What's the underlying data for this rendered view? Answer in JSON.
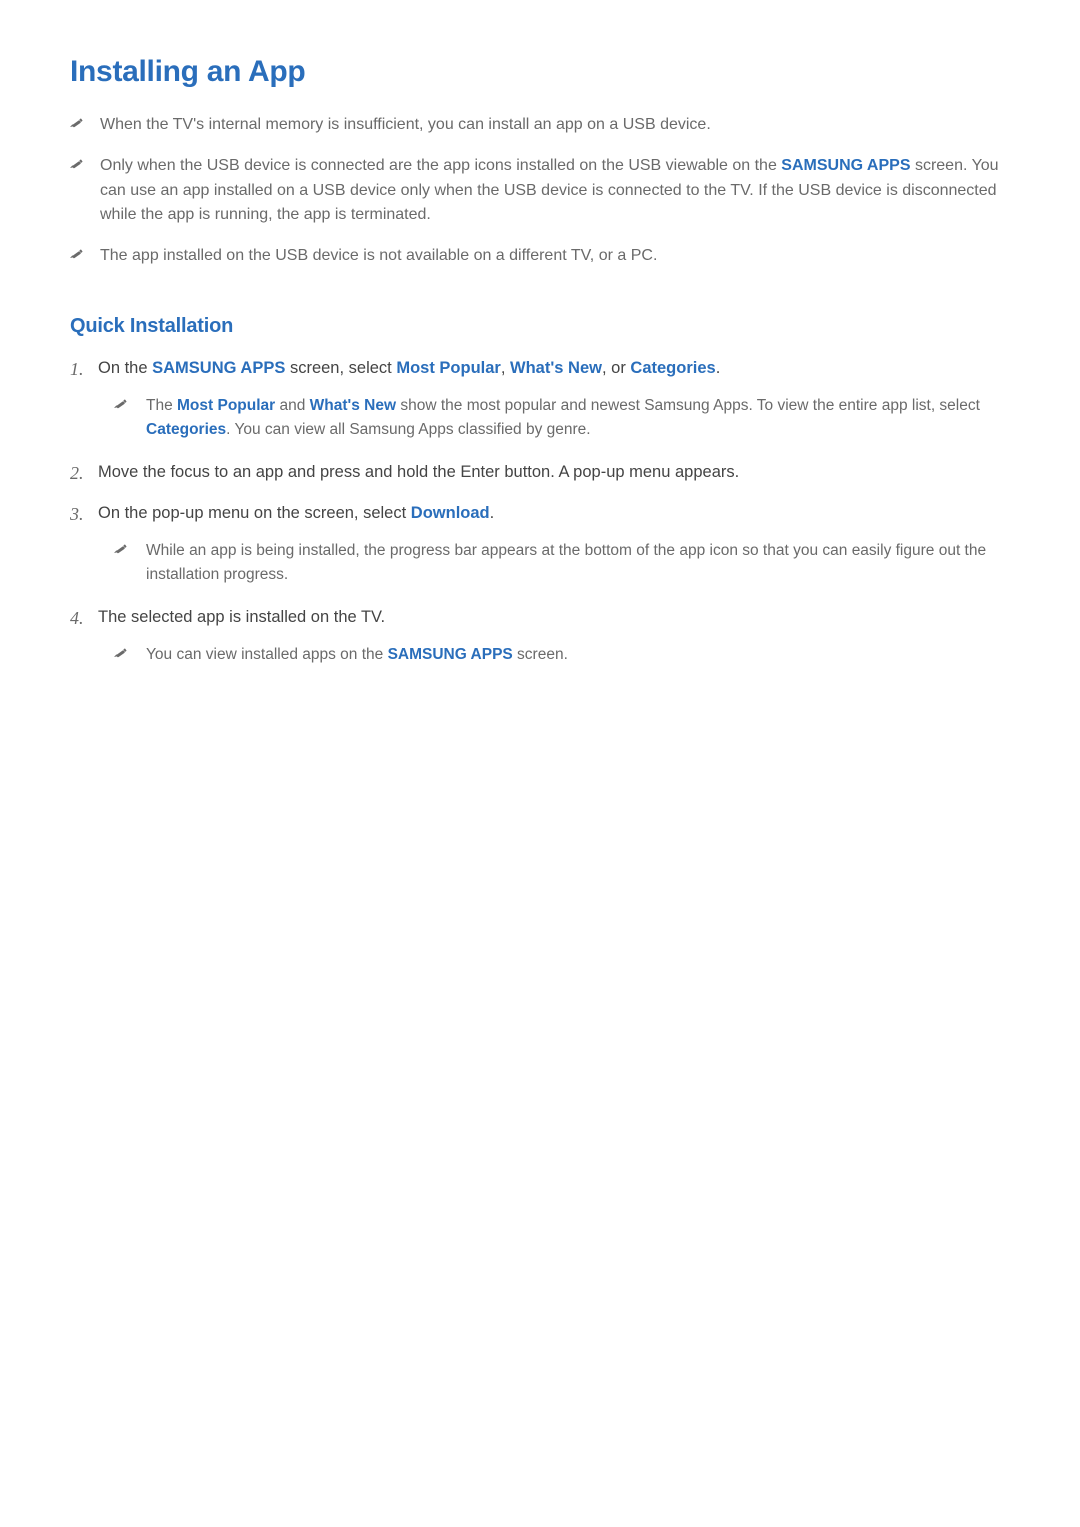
{
  "title": "Installing an App",
  "notes": {
    "n1": {
      "t1": "When the TV's internal memory is insufficient, you can install an app on a USB device."
    },
    "n2": {
      "t1": "Only when the USB device is connected are the app icons installed on the USB viewable on the ",
      "hl1": "SAMSUNG APPS",
      "t2": " screen. You can use an app installed on a USB device only when the USB device is connected to the TV. If the USB device is disconnected while the app is running, the app is terminated."
    },
    "n3": {
      "t1": "The app installed on the USB device is not available on a different TV, or a PC."
    }
  },
  "subTitle": "Quick Installation",
  "steps": {
    "s1": {
      "num": "1.",
      "t1": "On the ",
      "hl1": "SAMSUNG APPS",
      "t2": " screen, select ",
      "hl2": "Most Popular",
      "t3": ", ",
      "hl3": "What's New",
      "t4": ", or ",
      "hl4": "Categories",
      "t5": ".",
      "note": {
        "t1": "The ",
        "hl1": "Most Popular",
        "t2": " and ",
        "hl2": "What's New",
        "t3": " show the most popular and newest Samsung Apps. To view the entire app list, select ",
        "hl3": "Categories",
        "t4": ". You can view all Samsung Apps classified by genre."
      }
    },
    "s2": {
      "num": "2.",
      "t1": "Move the focus to an app and press and hold the Enter button. A pop-up menu appears."
    },
    "s3": {
      "num": "3.",
      "t1": "On the pop-up menu on the screen, select ",
      "hl1": "Download",
      "t2": ".",
      "note": {
        "t1": "While an app is being installed, the progress bar appears at the bottom of the app icon so that you can easily figure out the installation progress."
      }
    },
    "s4": {
      "num": "4.",
      "t1": "The selected app is installed on the TV.",
      "note": {
        "t1": "You can view installed apps on the ",
        "hl1": "SAMSUNG APPS",
        "t2": " screen."
      }
    }
  }
}
